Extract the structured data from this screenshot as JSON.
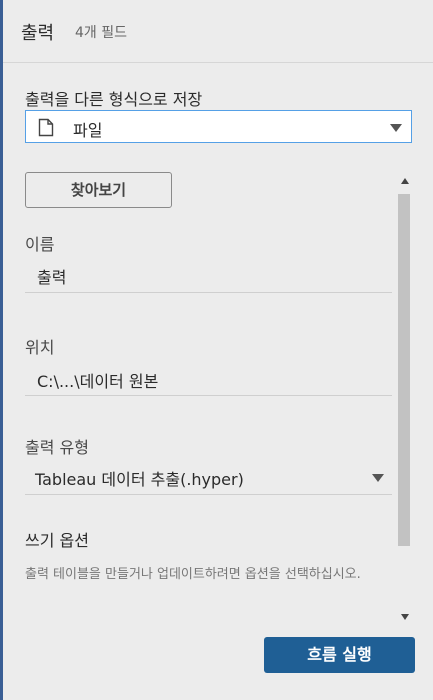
{
  "header": {
    "title": "출력",
    "subtitle": "4개 필드"
  },
  "save_as": {
    "label": "출력을 다른 형식으로 저장",
    "selected": "파일",
    "icon": "file-icon"
  },
  "browse_button": "찾아보기",
  "name_field": {
    "label": "이름",
    "value": "출력"
  },
  "location_field": {
    "label": "위치",
    "value": "C:\\...\\데이터 원본"
  },
  "output_type": {
    "label": "출력 유형",
    "value": "Tableau 데이터 추출(.hyper)"
  },
  "write_options": {
    "title": "쓰기 옵션",
    "description": "출력 테이블을 만들거나 업데이트하려면 옵션을 선택하십시오."
  },
  "run_flow_button": "흐름 실행",
  "colors": {
    "accent": "#1f5f95",
    "focus_border": "#55a0e6",
    "left_edge": "#3a5f95"
  }
}
